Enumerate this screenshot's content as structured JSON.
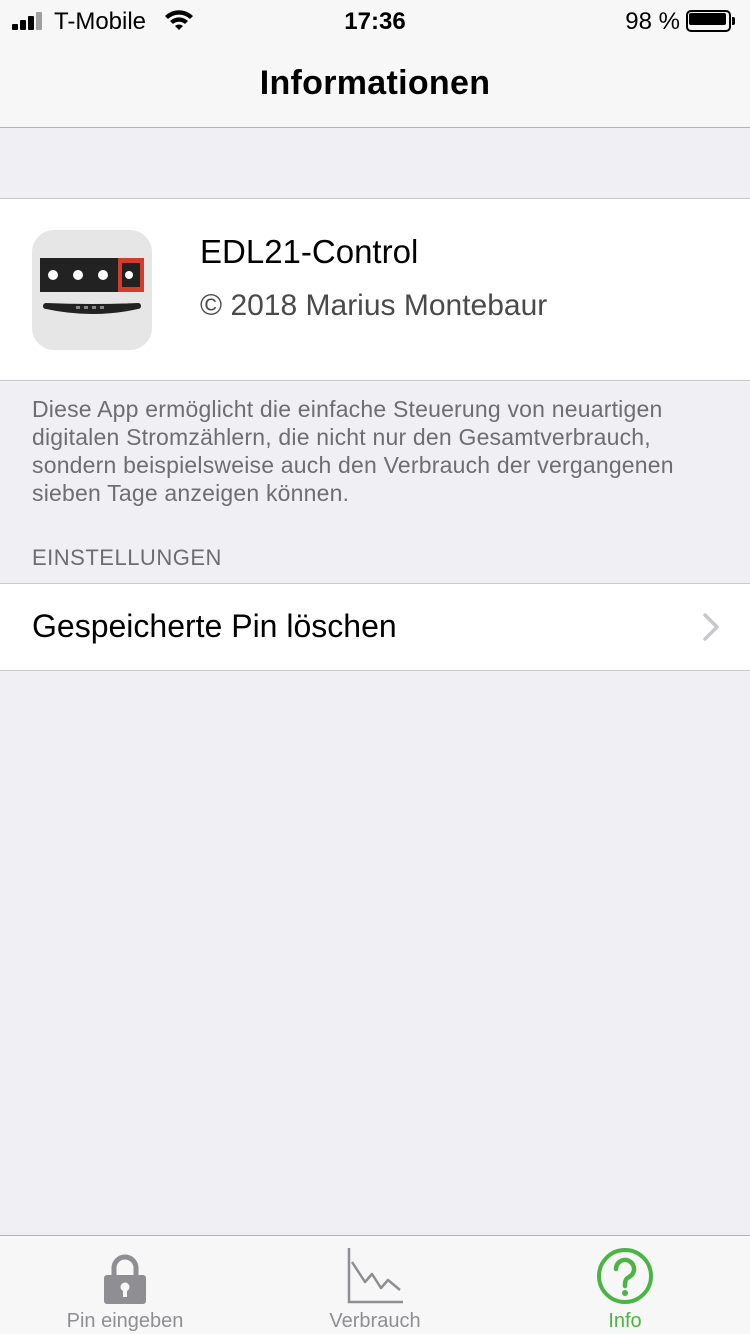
{
  "status_bar": {
    "carrier": "T-Mobile",
    "time": "17:36",
    "battery_percent": "98 %",
    "battery_level": 0.98
  },
  "nav": {
    "title": "Informationen"
  },
  "app_info": {
    "name": "EDL21-Control",
    "copyright": "© 2018 Marius Montebaur",
    "description": "Diese App ermöglicht die einfache Steuerung von neuartigen digitalen Stromzählern, die nicht nur den Gesamtverbrauch, sondern beispielsweise auch den Verbrauch der vergangenen sieben Tage anzeigen können."
  },
  "settings": {
    "header": "EINSTELLUNGEN",
    "items": [
      {
        "label": "Gespeicherte Pin löschen",
        "icon": "chevron-right-icon"
      }
    ]
  },
  "tab_bar": {
    "tabs": [
      {
        "label": "Pin eingeben",
        "icon": "lock-icon",
        "active": false
      },
      {
        "label": "Verbrauch",
        "icon": "chart-icon",
        "active": false
      },
      {
        "label": "Info",
        "icon": "question-circle-icon",
        "active": true
      }
    ],
    "active_color": "#4bb543",
    "inactive_color": "#8e8e93"
  }
}
